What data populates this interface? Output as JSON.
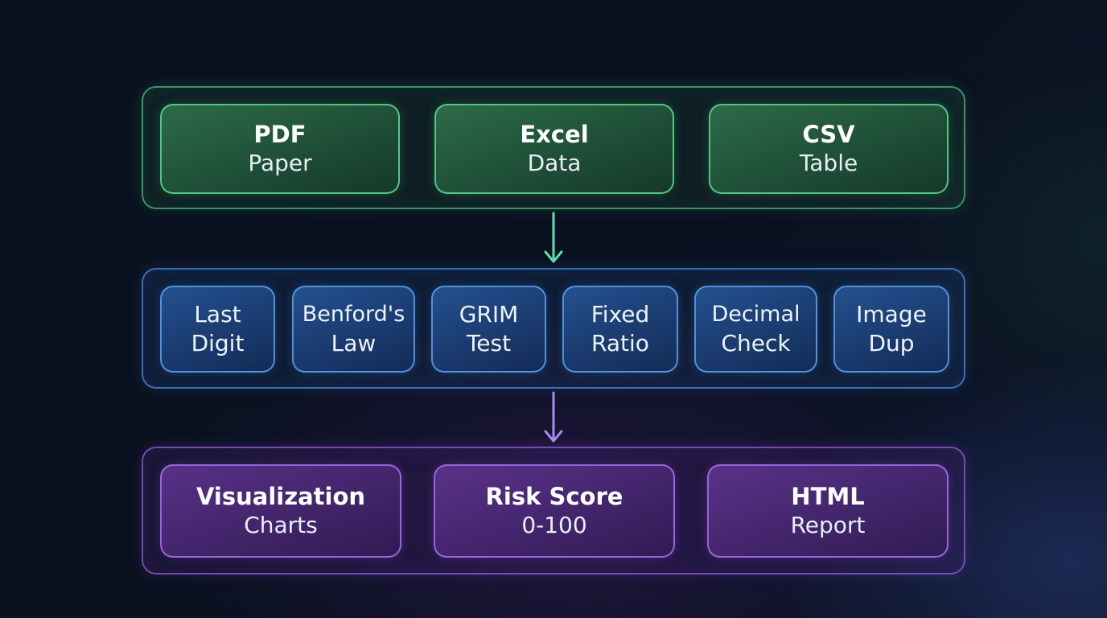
{
  "colors": {
    "input_accent": "#5adc8c",
    "analysis_accent": "#5aa0f0",
    "output_accent": "#aa6ef0",
    "arrow_1": "#5fe0a8",
    "arrow_2": "#a98af5"
  },
  "input_nodes": [
    {
      "title": "PDF",
      "subtitle": "Paper"
    },
    {
      "title": "Excel",
      "subtitle": "Data"
    },
    {
      "title": "CSV",
      "subtitle": "Table"
    }
  ],
  "analysis_nodes": [
    {
      "line1": "Last",
      "line2": "Digit"
    },
    {
      "line1": "Benford's",
      "line2": "Law"
    },
    {
      "line1": "GRIM",
      "line2": "Test"
    },
    {
      "line1": "Fixed",
      "line2": "Ratio"
    },
    {
      "line1": "Decimal",
      "line2": "Check"
    },
    {
      "line1": "Image",
      "line2": "Dup"
    }
  ],
  "output_nodes": [
    {
      "title": "Visualization",
      "subtitle": "Charts"
    },
    {
      "title": "Risk Score",
      "subtitle": "0-100"
    },
    {
      "title": "HTML",
      "subtitle": "Report"
    }
  ]
}
